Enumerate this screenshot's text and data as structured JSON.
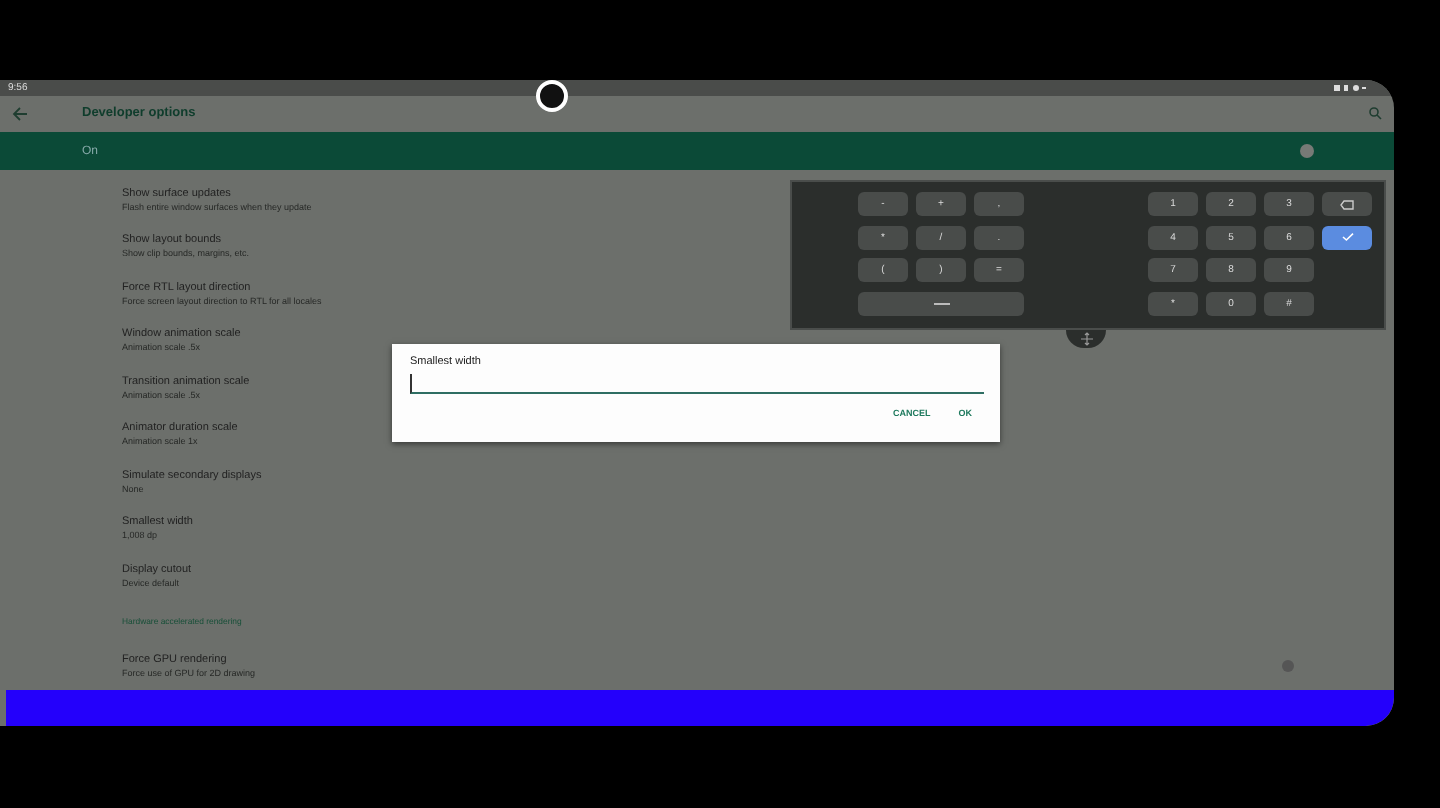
{
  "status_bar": {
    "time": "9:56"
  },
  "toolbar": {
    "title": "Developer options"
  },
  "master_switch": {
    "label": "On",
    "on": true
  },
  "settings": [
    {
      "kind": "item",
      "title": "Show surface updates",
      "subtitle": "Flash entire window surfaces when they update"
    },
    {
      "kind": "item",
      "title": "Show layout bounds",
      "subtitle": "Show clip bounds, margins, etc."
    },
    {
      "kind": "item",
      "title": "Force RTL layout direction",
      "subtitle": "Force screen layout direction to RTL for all locales"
    },
    {
      "kind": "item",
      "title": "Window animation scale",
      "subtitle": "Animation scale .5x"
    },
    {
      "kind": "item",
      "title": "Transition animation scale",
      "subtitle": "Animation scale .5x"
    },
    {
      "kind": "item",
      "title": "Animator duration scale",
      "subtitle": "Animation scale 1x"
    },
    {
      "kind": "item",
      "title": "Simulate secondary displays",
      "subtitle": "None"
    },
    {
      "kind": "item",
      "title": "Smallest width",
      "subtitle": "1,008 dp"
    },
    {
      "kind": "item",
      "title": "Display cutout",
      "subtitle": "Device default"
    },
    {
      "kind": "header",
      "title": "Hardware accelerated rendering"
    },
    {
      "kind": "toggle",
      "title": "Force GPU rendering",
      "subtitle": "Force use of GPU for 2D drawing",
      "on": false
    }
  ],
  "dialog": {
    "title": "Smallest width",
    "buttons": [
      "CANCEL",
      "OK"
    ]
  },
  "keypad": {
    "symbol_keys": [
      {
        "kind": "key",
        "label": "-"
      },
      {
        "kind": "key",
        "label": "+"
      },
      {
        "kind": "key",
        "label": ","
      },
      {
        "kind": "key",
        "label": "*"
      },
      {
        "kind": "key",
        "label": "/"
      },
      {
        "kind": "key",
        "label": "."
      },
      {
        "kind": "key",
        "label": "("
      },
      {
        "kind": "key",
        "label": ")"
      },
      {
        "kind": "key",
        "label": "="
      },
      {
        "kind": "space"
      }
    ],
    "number_keys": [
      {
        "kind": "key",
        "label": "1"
      },
      {
        "kind": "key",
        "label": "2"
      },
      {
        "kind": "key",
        "label": "3"
      },
      {
        "kind": "backspace"
      },
      {
        "kind": "key",
        "label": "4"
      },
      {
        "kind": "key",
        "label": "5"
      },
      {
        "kind": "key",
        "label": "6"
      },
      {
        "kind": "enter"
      },
      {
        "kind": "key",
        "label": "7"
      },
      {
        "kind": "key",
        "label": "8"
      },
      {
        "kind": "key",
        "label": "9"
      },
      {
        "kind": "blank"
      },
      {
        "kind": "key",
        "label": "*"
      },
      {
        "kind": "key",
        "label": "0"
      },
      {
        "kind": "key",
        "label": "#"
      }
    ]
  }
}
